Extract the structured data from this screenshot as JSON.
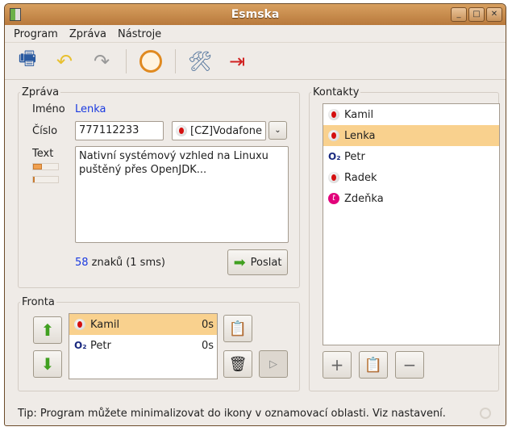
{
  "window": {
    "title": "Esmska"
  },
  "menu": [
    "Program",
    "Zpráva",
    "Nástroje"
  ],
  "toolbar": {
    "icons": [
      "compose-icon",
      "undo-icon",
      "redo-icon",
      "history-icon",
      "settings-icon",
      "quit-icon"
    ]
  },
  "message": {
    "legend": "Zpráva",
    "name_label": "Iméno",
    "name_value": "Lenka",
    "number_label": "Číslo",
    "number_value": "777112233",
    "operator": "[CZ]Vodafone",
    "text_label": "Text",
    "text_value": "Nativní systémový vzhled na Linuxu puštěný přes OpenJDK...",
    "progress_sms": 0.35,
    "progress_total": 0.05,
    "count_number": "58",
    "count_rest": " znaků (1 sms)",
    "send_label": "Poslat"
  },
  "queue": {
    "legend": "Fronta",
    "items": [
      {
        "name": "Kamil",
        "time": "0s",
        "operator": "vodafone"
      },
      {
        "name": "Petr",
        "time": "0s",
        "operator": "o2"
      }
    ]
  },
  "contacts": {
    "legend": "Kontakty",
    "items": [
      {
        "name": "Kamil",
        "operator": "vodafone"
      },
      {
        "name": "Lenka",
        "operator": "vodafone",
        "selected": true
      },
      {
        "name": "Petr",
        "operator": "o2"
      },
      {
        "name": "Radek",
        "operator": "vodafone"
      },
      {
        "name": "Zdeňka",
        "operator": "tmobile"
      }
    ]
  },
  "status": {
    "tip": "Tip: Program můžete minimalizovat do ikony v oznamovací oblasti. Viz nastavení."
  }
}
